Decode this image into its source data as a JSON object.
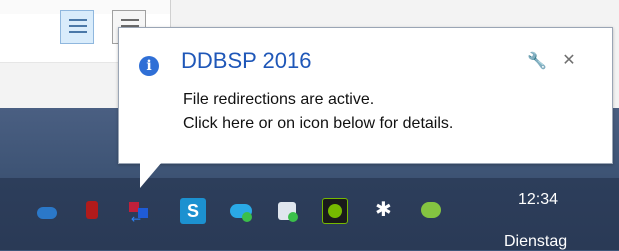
{
  "balloon": {
    "title": "DDBSP 2016",
    "line1": "File redirections are active.",
    "line2": "Click here or on icon below for details.",
    "info_icon": "info-icon",
    "settings_icon": "wrench-icon",
    "close_icon": "close-icon"
  },
  "tray": {
    "icons": [
      {
        "name": "onedrive-cloud-icon"
      },
      {
        "name": "red-app-icon"
      },
      {
        "name": "file-redirection-icon"
      },
      {
        "name": "s-app-icon"
      },
      {
        "name": "cloud-sync-icon"
      },
      {
        "name": "dropbox-icon"
      },
      {
        "name": "nvidia-icon"
      },
      {
        "name": "bluetooth-icon"
      },
      {
        "name": "green-app-icon"
      }
    ]
  },
  "clock": {
    "time": "12:34",
    "day": "Dienstag"
  },
  "colors": {
    "balloon_title": "#1f57b8",
    "taskbar": "#2d3e5b",
    "info_blue": "#2f6fd6"
  }
}
